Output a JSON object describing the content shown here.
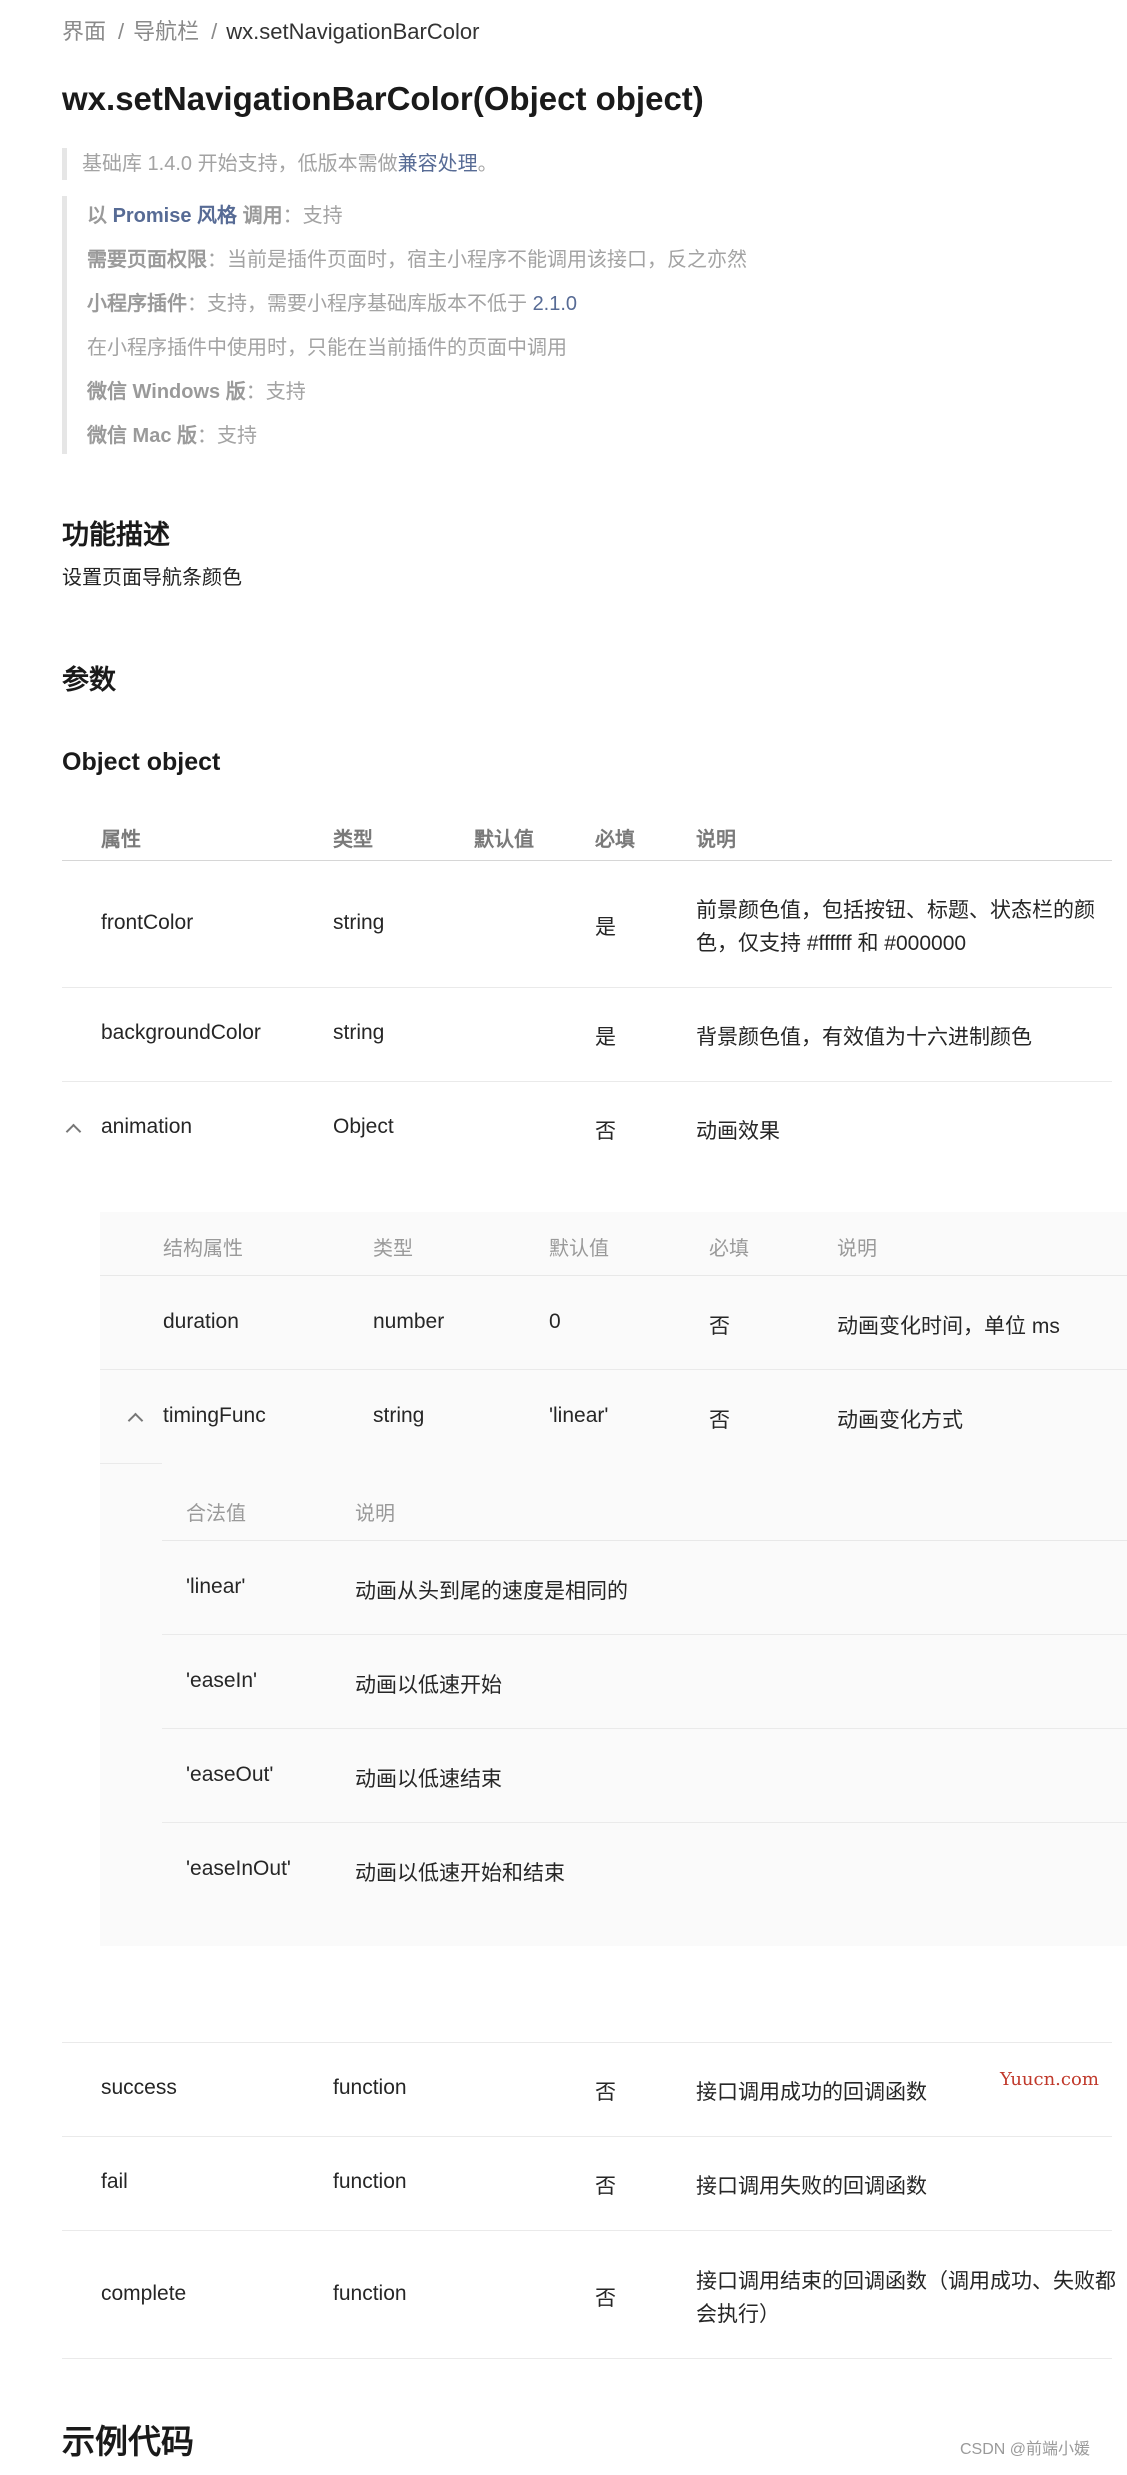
{
  "breadcrumb": {
    "items": [
      "界面",
      "导航栏"
    ],
    "current": "wx.setNavigationBarColor"
  },
  "title": "wx.setNavigationBarColor(Object object)",
  "support_note": {
    "prefix": "基础库 1.4.0 开始支持，低版本需做",
    "link": "兼容处理",
    "suffix": "。"
  },
  "info": {
    "promise": {
      "a": "以 ",
      "b": "Promise 风格",
      "c": " 调用",
      "val": "：支持"
    },
    "permission": {
      "label": "需要页面权限",
      "val": "：当前是插件页面时，宿主小程序不能调用该接口，反之亦然"
    },
    "plugin": {
      "label": "小程序插件",
      "val": "：支持，需要小程序基础库版本不低于 ",
      "ver": "2.1.0"
    },
    "plugin_use": "在小程序插件中使用时，只能在当前插件的页面中调用",
    "windows": {
      "label": "微信 Windows 版",
      "val": "：支持"
    },
    "mac": {
      "label": "微信 Mac 版",
      "val": "：支持"
    }
  },
  "sections": {
    "func": "功能描述",
    "func_desc": "设置页面导航条颜色",
    "params": "参数",
    "object": "Object object",
    "example": "示例代码"
  },
  "table": {
    "headers": [
      "属性",
      "类型",
      "默认值",
      "必填",
      "说明"
    ],
    "rows": [
      {
        "name": "frontColor",
        "type": "string",
        "default": "",
        "required": "是",
        "desc": "前景颜色值，包括按钮、标题、状态栏的颜",
        "desc2": "色，仅支持 #ffffff 和 #000000"
      },
      {
        "name": "backgroundColor",
        "type": "string",
        "default": "",
        "required": "是",
        "desc": "背景颜色值，有效值为十六进制颜色"
      },
      {
        "name": "animation",
        "type": "Object",
        "default": "",
        "required": "否",
        "desc": "动画效果"
      },
      {
        "name": "success",
        "type": "function",
        "default": "",
        "required": "否",
        "desc": "接口调用成功的回调函数"
      },
      {
        "name": "fail",
        "type": "function",
        "default": "",
        "required": "否",
        "desc": "接口调用失败的回调函数"
      },
      {
        "name": "complete",
        "type": "function",
        "default": "",
        "required": "否",
        "desc": "接口调用结束的回调函数（调用成功、失败都",
        "desc2": "会执行）"
      }
    ]
  },
  "subtable": {
    "headers": [
      "结构属性",
      "类型",
      "默认值",
      "必填",
      "说明"
    ],
    "rows": [
      {
        "name": "duration",
        "type": "number",
        "default": "0",
        "required": "否",
        "desc": "动画变化时间，单位 ms"
      },
      {
        "name": "timingFunc",
        "type": "string",
        "default": "'linear'",
        "required": "否",
        "desc": "动画变化方式"
      }
    ]
  },
  "valtable": {
    "headers": [
      "合法值",
      "说明"
    ],
    "rows": [
      {
        "val": "'linear'",
        "desc": "动画从头到尾的速度是相同的"
      },
      {
        "val": "'easeIn'",
        "desc": "动画以低速开始"
      },
      {
        "val": "'easeOut'",
        "desc": "动画以低速结束"
      },
      {
        "val": "'easeInOut'",
        "desc": "动画以低速开始和结束"
      }
    ]
  },
  "watermarks": {
    "site": "Yuucn.com",
    "author": "CSDN @前端小媛"
  }
}
